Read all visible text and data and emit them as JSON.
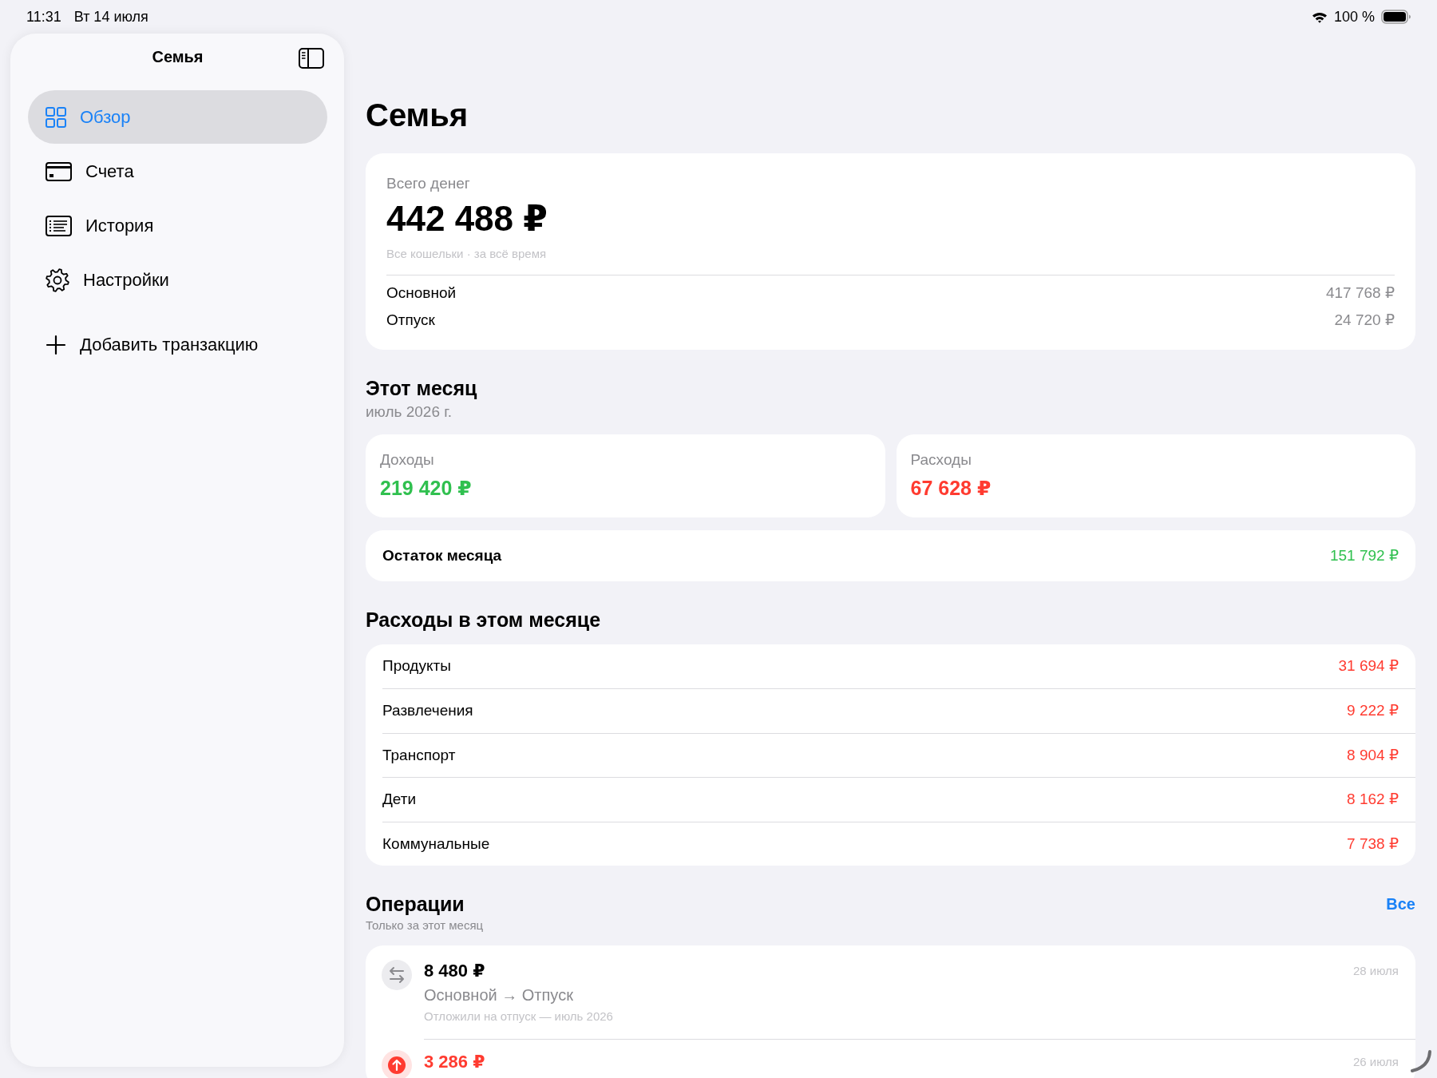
{
  "status_bar": {
    "time": "11:31",
    "date": "Вт 14 июля",
    "battery": "100 %"
  },
  "sidebar": {
    "title": "Семья",
    "items": [
      {
        "kind": "overview",
        "label": "Обзор",
        "selected": true
      },
      {
        "kind": "accounts",
        "label": "Счета",
        "selected": false
      },
      {
        "kind": "history",
        "label": "История",
        "selected": false
      },
      {
        "kind": "settings",
        "label": "Настройки",
        "selected": false
      }
    ],
    "action": {
      "label": "Добавить транзакцию"
    }
  },
  "page": {
    "title": "Семья"
  },
  "total": {
    "label": "Всего денег",
    "amount": "442 488 ₽",
    "note": "Все кошельки · за всё время",
    "wallets": [
      {
        "name": "Основной",
        "amount": "417 768 ₽"
      },
      {
        "name": "Отпуск",
        "amount": "24 720 ₽"
      }
    ]
  },
  "month": {
    "title": "Этот месяц",
    "subtitle": "июль 2026 г.",
    "income": {
      "label": "Доходы",
      "amount": "219 420 ₽"
    },
    "expenses": {
      "label": "Расходы",
      "amount": "67 628 ₽"
    },
    "balance": {
      "label": "Остаток месяца",
      "amount": "151 792 ₽"
    }
  },
  "categories": {
    "title": "Расходы в этом месяце",
    "rows": [
      {
        "name": "Продукты",
        "amount": "31 694 ₽"
      },
      {
        "name": "Развлечения",
        "amount": "9 222 ₽"
      },
      {
        "name": "Транспорт",
        "amount": "8 904 ₽"
      },
      {
        "name": "Дети",
        "amount": "8 162 ₽"
      },
      {
        "name": "Коммунальные",
        "amount": "7 738 ₽"
      }
    ]
  },
  "operations": {
    "title": "Операции",
    "subtitle": "Только за этот месяц",
    "link": "Все",
    "items": [
      {
        "kind": "transfer",
        "amount": "8 480 ₽",
        "route": "Основной → Отпуск",
        "note": "Отложили на отпуск — июль 2026",
        "date": "28 июля"
      },
      {
        "kind": "expense",
        "amount": "3 286 ₽",
        "date": "26 июля"
      }
    ]
  }
}
